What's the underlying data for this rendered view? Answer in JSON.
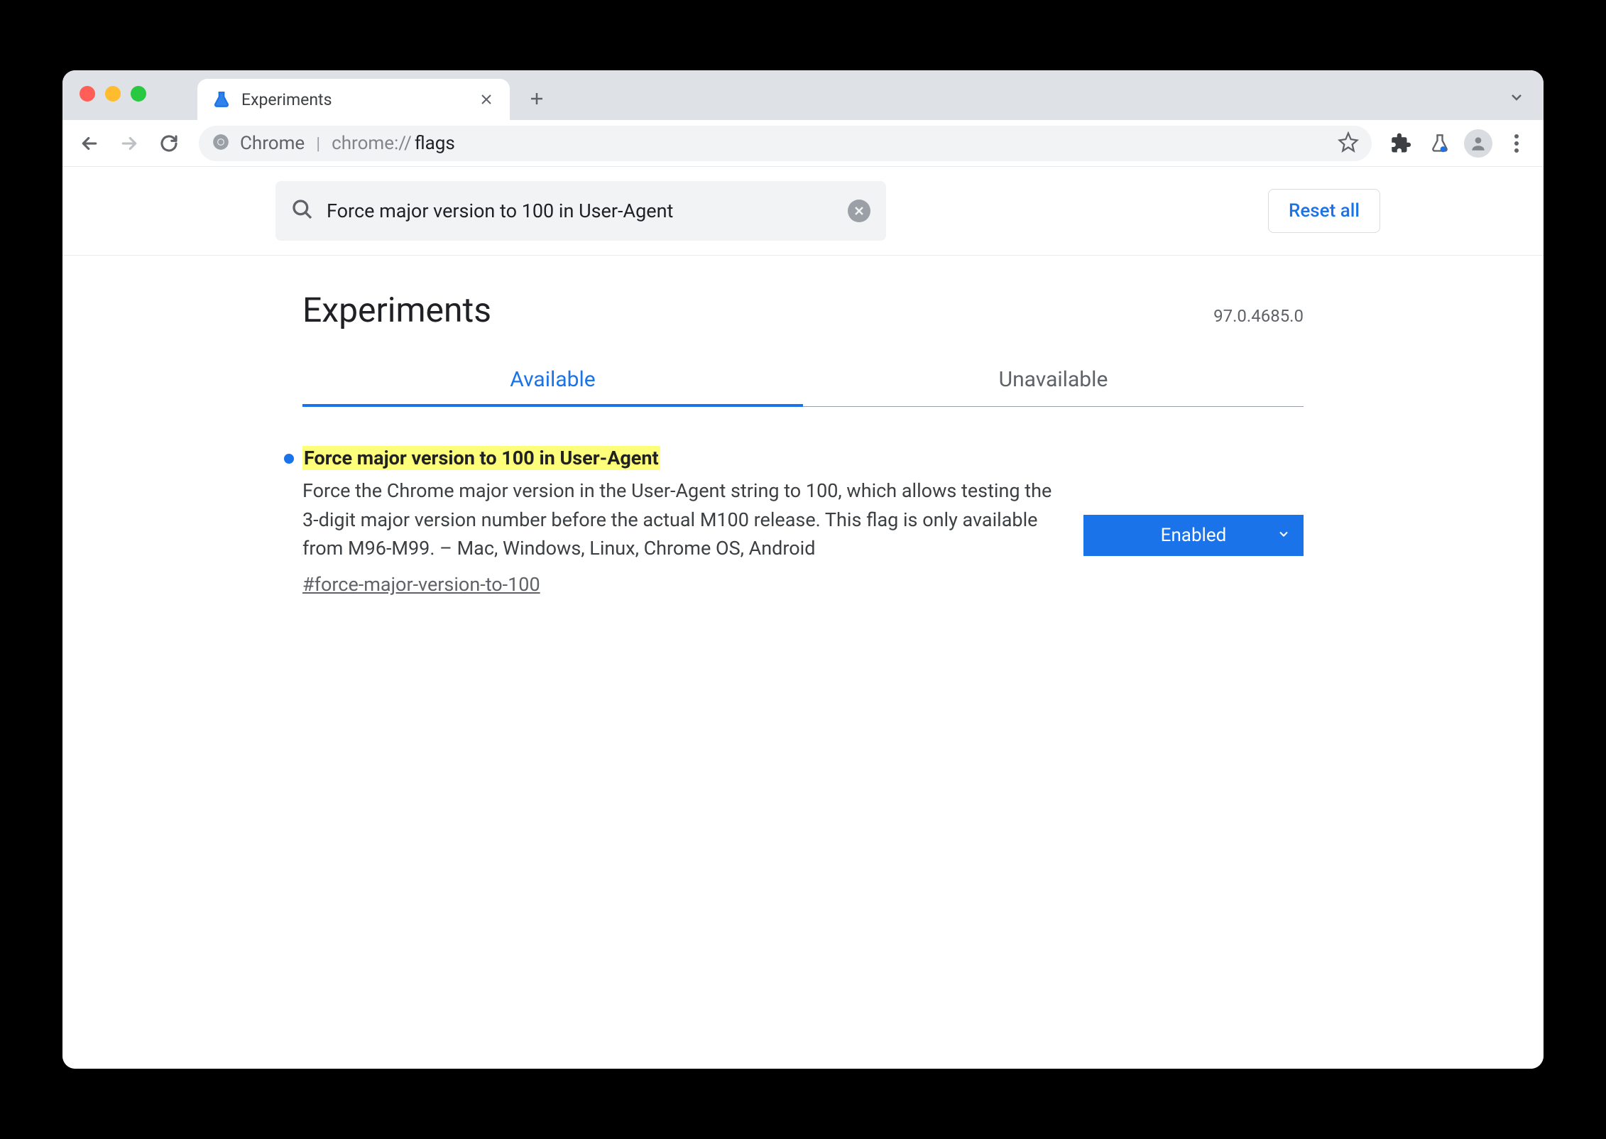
{
  "browser_tab": {
    "title": "Experiments"
  },
  "omnibox": {
    "site_label": "Chrome",
    "url_scheme": "chrome://",
    "url_path": "flags"
  },
  "search": {
    "value": "Force major version to 100 in User-Agent"
  },
  "reset_button": "Reset all",
  "page_header": {
    "title": "Experiments",
    "version": "97.0.4685.0"
  },
  "tabs": {
    "available": "Available",
    "unavailable": "Unavailable"
  },
  "flag": {
    "title": "Force major version to 100 in User-Agent",
    "description": "Force the Chrome major version in the User-Agent string to 100, which allows testing the 3-digit major version number before the actual M100 release. This flag is only available from M96-M99. – Mac, Windows, Linux, Chrome OS, Android",
    "anchor": "#force-major-version-to-100",
    "select_value": "Enabled"
  }
}
